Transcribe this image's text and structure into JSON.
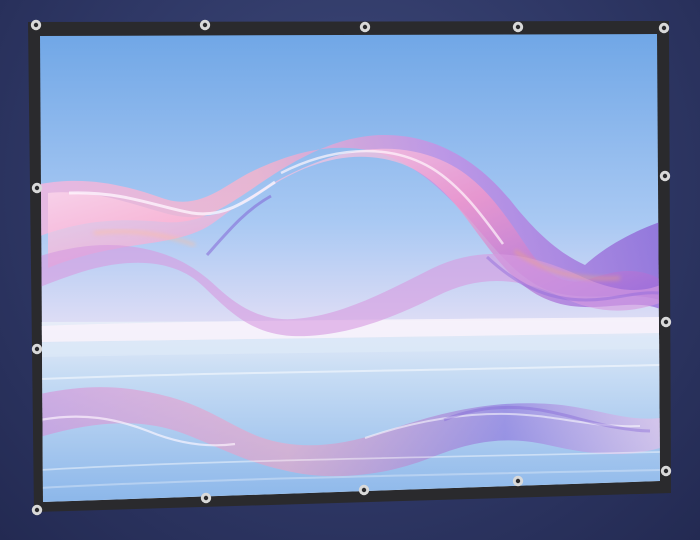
{
  "scene": {
    "subject": "projector-screen-with-grommets",
    "frame_color": "#2a2a2d",
    "grommet_ring_color": "#d9d9d9",
    "grommet_hole_color": "#2a2a2d",
    "background_color": "#2f3866",
    "sky_top_color": "#7fb1ea",
    "sky_horizon_color": "#f1e4f6",
    "water_color": "#b8d3f1",
    "ribbon_colors": [
      "#f3b8dd",
      "#d58ad9",
      "#8f63d7",
      "#ff9eb7"
    ]
  }
}
